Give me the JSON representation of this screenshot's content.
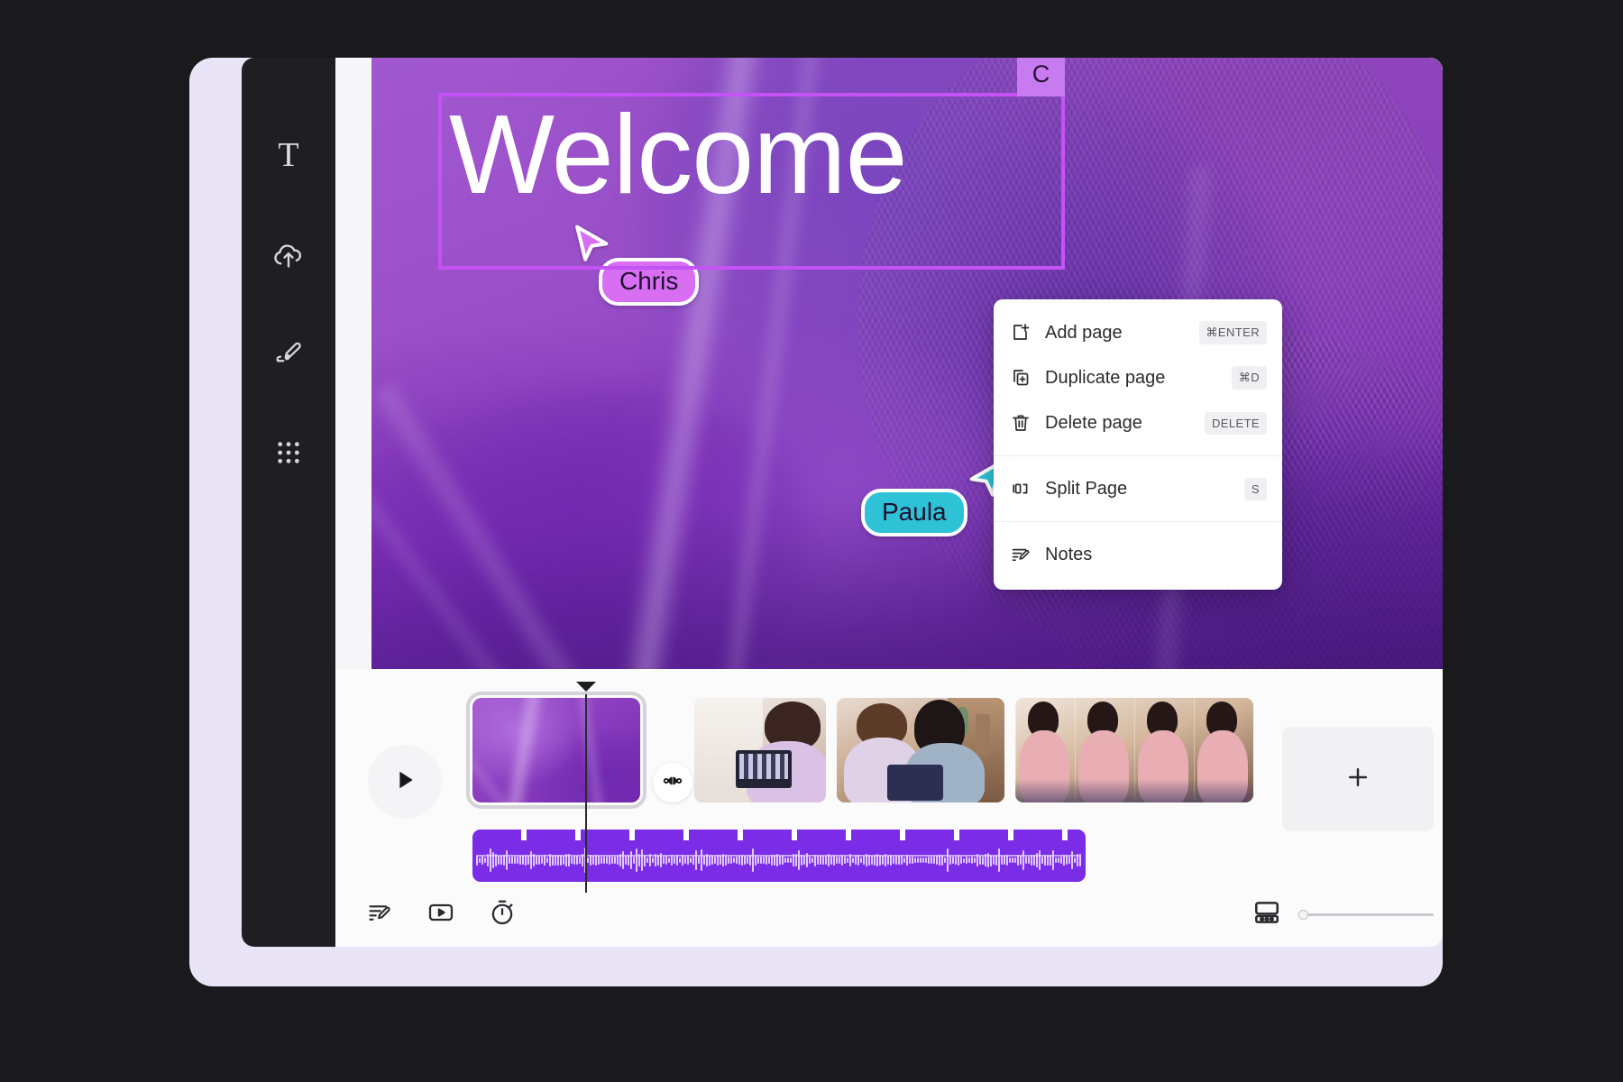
{
  "app": {
    "title": "Video editor"
  },
  "sidebar": {
    "items": [
      {
        "label": "Text",
        "icon": "text-icon"
      },
      {
        "label": "Uploads",
        "icon": "cloud-upload-icon"
      },
      {
        "label": "Draw",
        "icon": "pen-draw-icon"
      },
      {
        "label": "Apps",
        "icon": "apps-grid-icon"
      }
    ]
  },
  "canvas": {
    "title_text": "Welcome",
    "selection_badge": "C",
    "selection_color": "#c552f4"
  },
  "collaborators": [
    {
      "name": "Chris",
      "color": "#d86ef2"
    },
    {
      "name": "Paula",
      "color": "#2ec2d6"
    }
  ],
  "context_menu": {
    "items": [
      {
        "label": "Add page",
        "shortcut": "⌘ENTER",
        "icon": "add-page-icon"
      },
      {
        "label": "Duplicate page",
        "shortcut": "⌘D",
        "icon": "duplicate-page-icon"
      },
      {
        "label": "Delete page",
        "shortcut": "DELETE",
        "icon": "trash-icon"
      },
      {
        "label": "Split Page",
        "shortcut": "S",
        "icon": "split-page-icon"
      },
      {
        "label": "Notes",
        "shortcut": "",
        "icon": "notes-icon"
      }
    ]
  },
  "timeline": {
    "play_label": "Play",
    "add_clip_label": "+",
    "transition_label": "Transition",
    "clips": [
      {
        "name": "Purple silk intro",
        "kind": "purple",
        "selected": true
      },
      {
        "name": "Woman with laptop",
        "kind": "photo-laptop",
        "selected": false
      },
      {
        "name": "Two women with tablet",
        "kind": "photo-tablet",
        "selected": false
      },
      {
        "name": "Woman in pink repeated",
        "kind": "photo-pink",
        "selected": false
      }
    ],
    "audio": {
      "name": "Audio track",
      "color": "#7a2ce6"
    }
  },
  "bottom_bar": {
    "left_tools": [
      {
        "label": "Notes",
        "icon": "notes-icon"
      },
      {
        "label": "Preview",
        "icon": "video-play-icon"
      },
      {
        "label": "Timing",
        "icon": "stopwatch-icon"
      }
    ],
    "right_tools": [
      {
        "label": "Timeline view",
        "icon": "timeline-view-icon"
      }
    ]
  }
}
